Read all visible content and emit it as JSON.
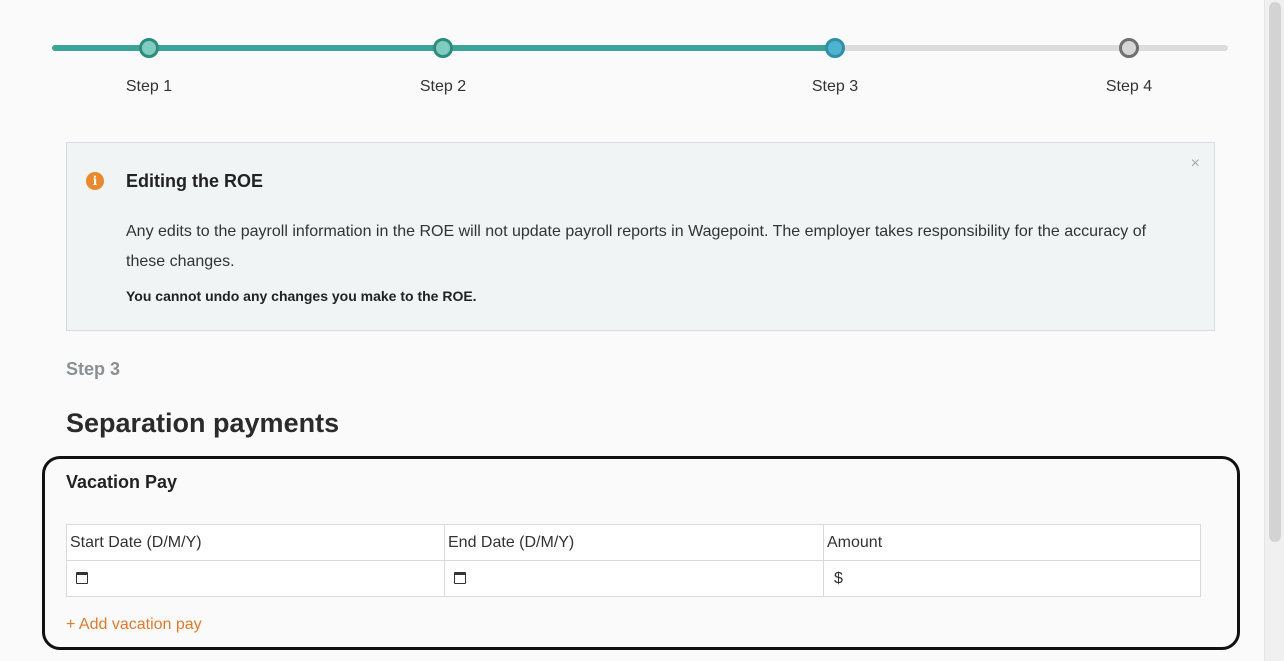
{
  "stepper": {
    "steps": [
      {
        "label": "Step 1"
      },
      {
        "label": "Step 2"
      },
      {
        "label": "Step 3"
      },
      {
        "label": "Step 4"
      }
    ],
    "current_step": 3
  },
  "alert": {
    "icon": "info-icon",
    "title": "Editing the ROE",
    "body": "Any edits to the payroll information in the ROE will not update payroll reports in Wagepoint. The employer takes responsibility for the accuracy of these changes.",
    "warning": "You cannot undo any changes you make to the ROE.",
    "close_glyph": "×"
  },
  "page": {
    "step_kicker": "Step 3",
    "section_title": "Separation payments"
  },
  "vacation_pay": {
    "title": "Vacation Pay",
    "columns": [
      "Start Date (D/M/Y)",
      "End Date (D/M/Y)",
      "Amount"
    ],
    "row": {
      "start_date": "",
      "end_date": "",
      "amount_prefix": "$",
      "amount": ""
    },
    "add_link": "+ Add vacation pay"
  },
  "colors": {
    "accent": "#3aa596",
    "link": "#e07a2d",
    "info": "#e8892e"
  }
}
